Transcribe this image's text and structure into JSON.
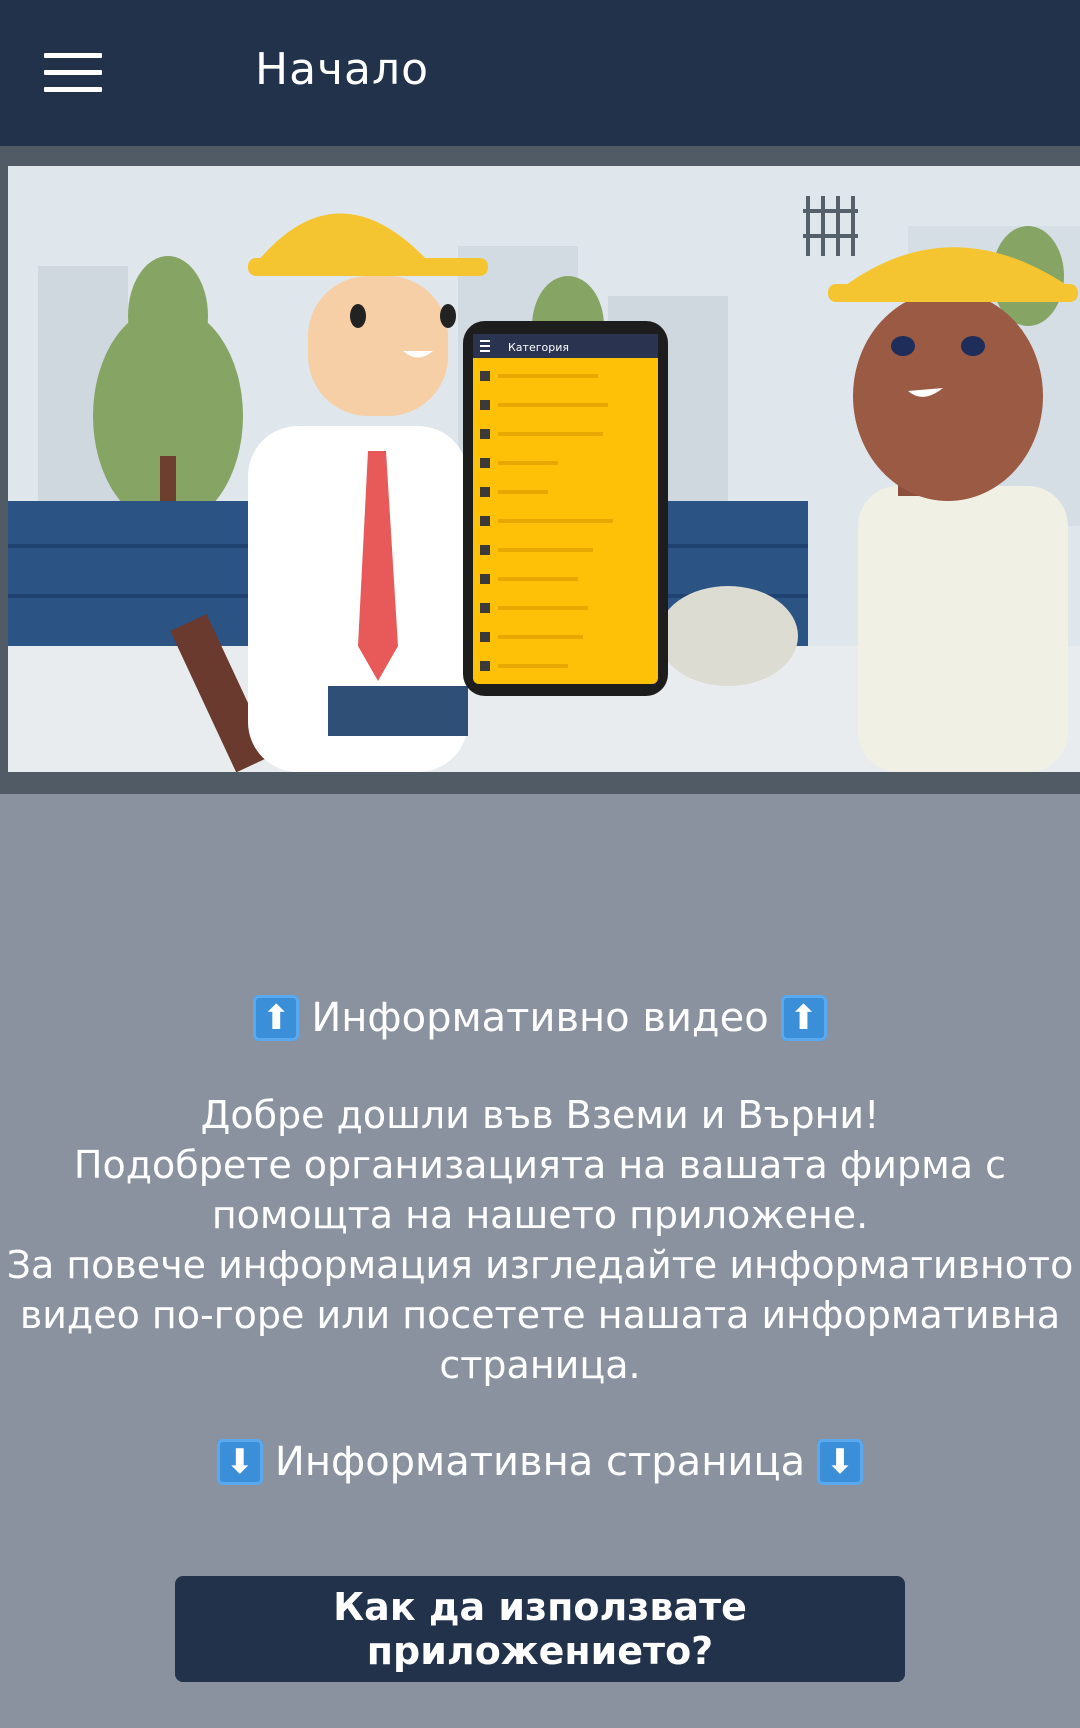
{
  "app_bar": {
    "menu_icon": "hamburger-menu-icon",
    "title": "Начало"
  },
  "video": {
    "phone_header": "Категория"
  },
  "info": {
    "video_heading": "Информативно видео",
    "video_arrow": "⬆",
    "welcome": "Добре дошли във Вземи и Върни!",
    "line1": "Подобрете организацията на вашата фирма с",
    "line2": "помощта на нашето приложене.",
    "line3": "За повече информация изгледайте информативното",
    "line4": "видео по-горе или посетете нашата информативна",
    "line5": "страница.",
    "page_heading": "Информативна страница",
    "page_arrow": "⬇"
  },
  "cta": {
    "label": "Как да използвате приложението?"
  },
  "colors": {
    "appbar": "#22324b",
    "background": "#8a929f",
    "phone_screen": "#ffc107"
  }
}
